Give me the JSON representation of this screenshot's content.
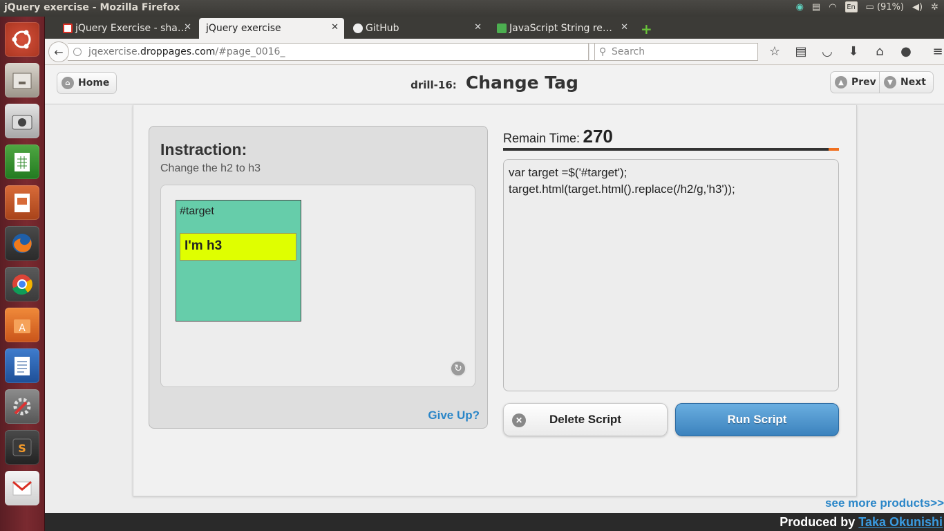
{
  "os": {
    "window_title": "jQuery exercise - Mozilla Firefox",
    "battery": "(91%)",
    "keyboard": "En"
  },
  "launcher": {
    "items": [
      "ubuntu-dash",
      "files",
      "screenshot",
      "libreoffice-calc",
      "libreoffice-impress",
      "firefox",
      "chrome",
      "software-center",
      "libreoffice-writer",
      "system-settings",
      "sublime-text",
      "gmail"
    ]
  },
  "browser": {
    "tabs": [
      {
        "label": "jQuery Exercise - sha…",
        "icon": "gmail-icon",
        "color": "#d93025"
      },
      {
        "label": "jQuery exercise",
        "icon": "page-icon",
        "color": "#cccccc"
      },
      {
        "label": "GitHub",
        "icon": "github-icon",
        "color": "#222222"
      },
      {
        "label": "JavaScript String re…",
        "icon": "w3-icon",
        "color": "#4caf50"
      }
    ],
    "new_tab": "+",
    "url_prefix": "jqexercise.",
    "url_domain": "droppages.com",
    "url_path": "/#page_0016_",
    "search_placeholder": "Search"
  },
  "page": {
    "home_label": "Home",
    "drill_label": "drill-16:",
    "drill_title": "Change Tag",
    "prev_label": "Prev",
    "next_label": "Next",
    "instruction_title": "Instraction:",
    "instruction_text": "Change the h2 to h3",
    "target_label": "#target",
    "target_child": "I'm h3",
    "give_up": "Give Up?",
    "remain_label": "Remain Time:",
    "remain_value": "270",
    "remain_fraction": 0.03,
    "code": "var target =$('#target');\ntarget.html(target.html().replace(/h2/g,'h3'));",
    "delete_label": "Delete Script",
    "run_label": "Run Script",
    "see_more": "see more products>>",
    "produced_by": "Produced by ",
    "author": "Taka Okunishi"
  }
}
